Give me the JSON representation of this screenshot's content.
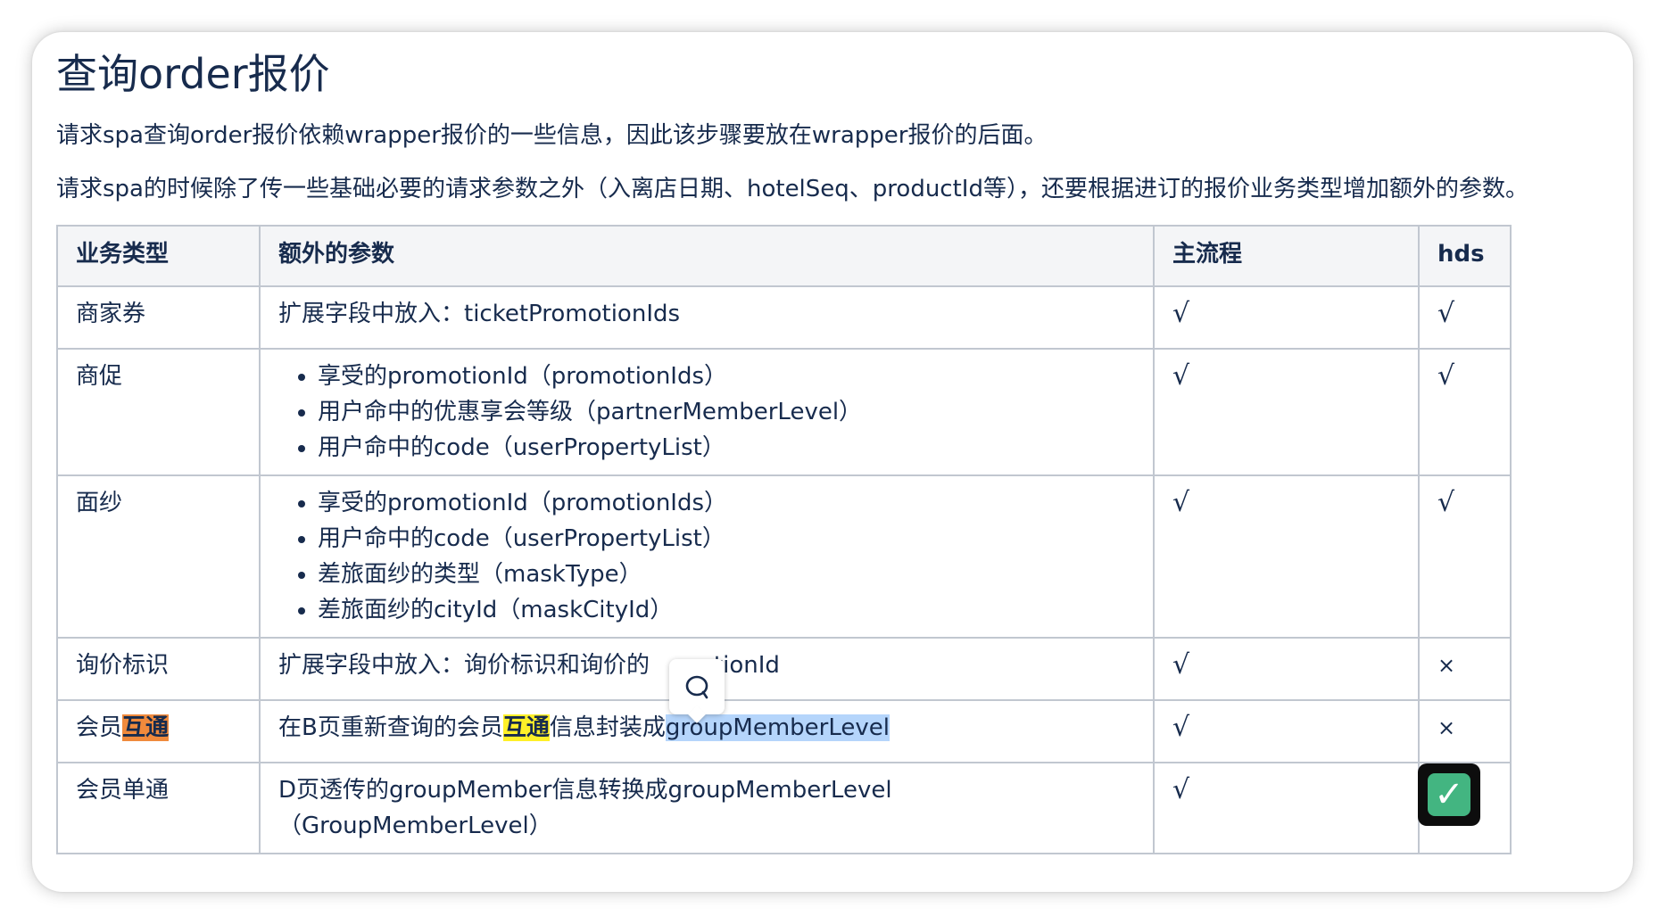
{
  "title": "查询order报价",
  "paragraphs": [
    "请求spa查询order报价依赖wrapper报价的一些信息，因此该步骤要放在wrapper报价的后面。",
    "请求spa的时候除了传一些基础必要的请求参数之外（入离店日期、hotelSeq、productId等），还要根据进订的报价业务类型增加额外的参数。"
  ],
  "table": {
    "headers": [
      "业务类型",
      "额外的参数",
      "主流程",
      "hds"
    ],
    "rows": [
      {
        "type": "商家券",
        "param": "扩展字段中放入：ticketPromotionIds",
        "main": "√",
        "hds": "√"
      },
      {
        "type": "商促",
        "params": [
          "享受的promotionId（promotionIds）",
          "用户命中的优惠享会等级（partnerMemberLevel）",
          "用户命中的code（userPropertyList）"
        ],
        "main": "√",
        "hds": "√"
      },
      {
        "type": "面纱",
        "params": [
          "享受的promotionId（promotionIds）",
          "用户命中的code（userPropertyList）",
          "差旅面纱的类型（maskType）",
          "差旅面纱的cityId（maskCityId）"
        ],
        "main": "√",
        "hds": "√"
      },
      {
        "type": "询价标识",
        "param_a": "扩展字段中放入：询价标识和询价的",
        "param_b": "otionId",
        "main": "√",
        "hds": "×"
      },
      {
        "type_a": "会员",
        "type_hl": "互通",
        "param_a": "在B页重新查询的会员",
        "param_hl": "互通",
        "param_b": "信息封装成",
        "param_sel": "groupMemberLevel",
        "main": "√",
        "hds": "×"
      },
      {
        "type": "会员单通",
        "param_line1": "D页透传的groupMember信息转换成groupMemberLevel",
        "param_line2": "（GroupMemberLevel）",
        "main": "√",
        "hds": "✓"
      }
    ]
  },
  "icons": {
    "comment": "comment-bubble-icon",
    "check_emoji": "white-check-mark-emoji"
  },
  "colors": {
    "highlight_orange": "#f08a3c",
    "highlight_yellow": "#fff028",
    "selection": "#b5d5fb",
    "check_green": "#43b581"
  }
}
